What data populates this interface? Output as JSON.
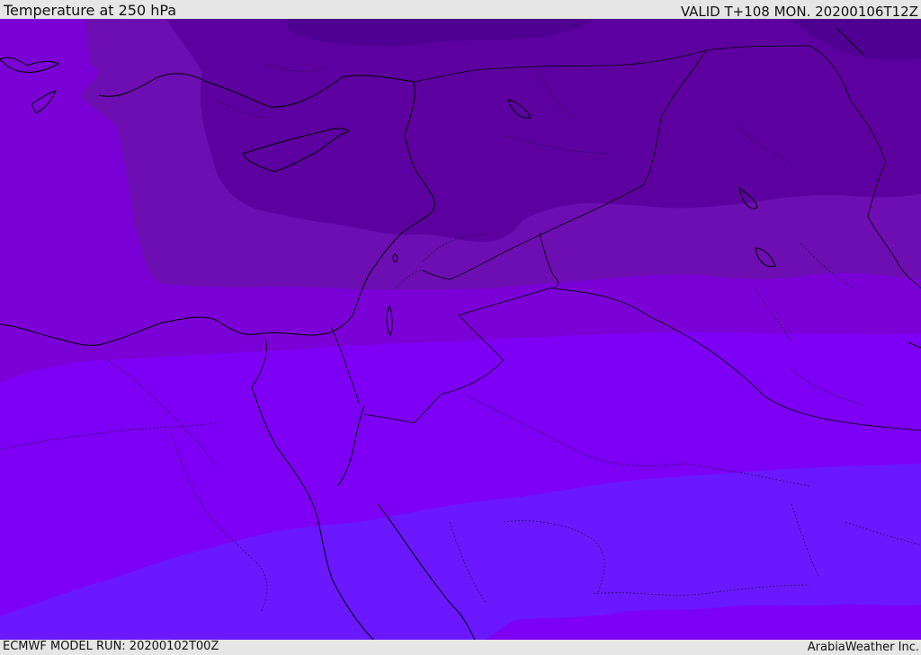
{
  "header": {
    "title": "Temperature at 250 hPa",
    "valid": "VALID T+108 MON. 20200106T12Z"
  },
  "footer": {
    "model_run": "ECMWF MODEL RUN: 20200102T00Z",
    "credit": "ArabiaWeather Inc."
  },
  "colors": {
    "band_darkest": "#4f0092",
    "band_dark": "#5d00a0",
    "band_mid": "#6c0eb2",
    "band_light": "#7a02d6",
    "band_violet": "#7d00f5",
    "band_blue_violet": "#6a18ff",
    "coast": "#000000",
    "border": "#2a1050"
  }
}
